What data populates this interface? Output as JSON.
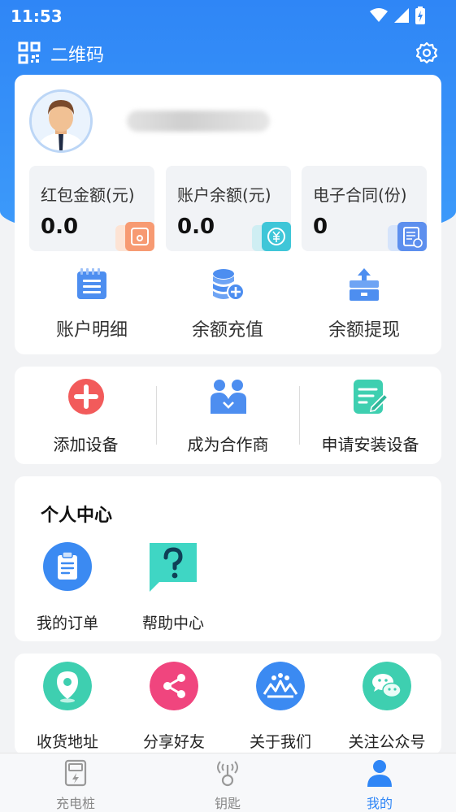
{
  "status_bar": {
    "time": "11:53"
  },
  "header": {
    "qr_label": "二维码"
  },
  "stats": [
    {
      "label": "红包金额(元)",
      "value": "0.0"
    },
    {
      "label": "账户余额(元)",
      "value": "0.0"
    },
    {
      "label": "电子合同(份)",
      "value": "0"
    }
  ],
  "account_actions": [
    {
      "label": "账户明细",
      "icon": "list-icon"
    },
    {
      "label": "余额充值",
      "icon": "coins-plus-icon"
    },
    {
      "label": "余额提现",
      "icon": "withdraw-icon"
    }
  ],
  "operations": [
    {
      "label": "添加设备",
      "icon": "plus-circle-icon"
    },
    {
      "label": "成为合作商",
      "icon": "partners-icon"
    },
    {
      "label": "申请安装设备",
      "icon": "edit-note-icon"
    }
  ],
  "personal": {
    "heading": "个人中心",
    "items": [
      {
        "label": "我的订单",
        "icon": "clipboard-icon"
      },
      {
        "label": "帮助中心",
        "icon": "question-chat-icon"
      }
    ]
  },
  "services": [
    {
      "label": "收货地址",
      "icon": "location-icon"
    },
    {
      "label": "分享好友",
      "icon": "share-icon"
    },
    {
      "label": "关于我们",
      "icon": "about-icon"
    },
    {
      "label": "关注公众号",
      "icon": "wechat-icon"
    }
  ],
  "tabs": [
    {
      "label": "充电桩",
      "icon": "charger-icon",
      "active": false
    },
    {
      "label": "钥匙",
      "icon": "key-signal-icon",
      "active": false
    },
    {
      "label": "我的",
      "icon": "person-icon",
      "active": true
    }
  ],
  "colors": {
    "primary": "#2f86f6",
    "add": "#f25b5b",
    "teal": "#3ecfb0",
    "pink": "#f0457e"
  }
}
